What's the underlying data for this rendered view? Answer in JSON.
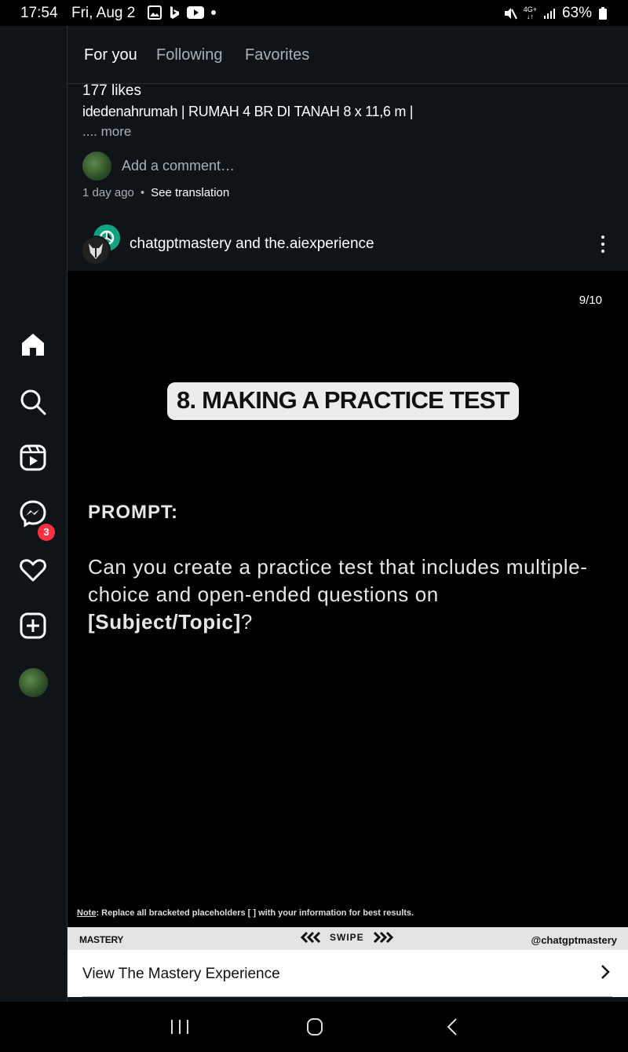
{
  "status_bar": {
    "time": "17:54",
    "date": "Fri, Aug 2",
    "network_top": "4G+",
    "battery": "63%"
  },
  "left_nav": {
    "messages_badge": "3"
  },
  "tabs": [
    {
      "label": "For you",
      "active": true
    },
    {
      "label": "Following",
      "active": false
    },
    {
      "label": "Favorites",
      "active": false
    }
  ],
  "prev_post": {
    "likes": "177 likes",
    "caption": "idedenahrumah | RUMAH 4 BR DI TANAH 8 x 11,6 m |",
    "more": ".... more",
    "add_comment": "Add a comment…",
    "time_ago": "1 day ago",
    "separator": "•",
    "see_translation": "See translation"
  },
  "post": {
    "users": "chatgptmastery and the.aiexperience",
    "counter": "9/10",
    "slide_title": "8. MAKING A PRACTICE TEST",
    "prompt_label": "PROMPT:",
    "prompt_text": "Can you create a practice test that includes multiple-choice and open-ended questions on ",
    "prompt_bold": "[Subject/Topic]",
    "prompt_end": "?",
    "note_label": "Note",
    "note_text": ": Replace all bracketed placeholders [ ] with your information for best results.",
    "strip_left": "MASTERY",
    "strip_swipe": "SWIPE",
    "strip_right": "@chatgptmastery",
    "cta": "View The Mastery Experience"
  },
  "colors": {
    "background": "#0f1418",
    "badge": "#ff3040",
    "openai_green": "#10a37f"
  }
}
